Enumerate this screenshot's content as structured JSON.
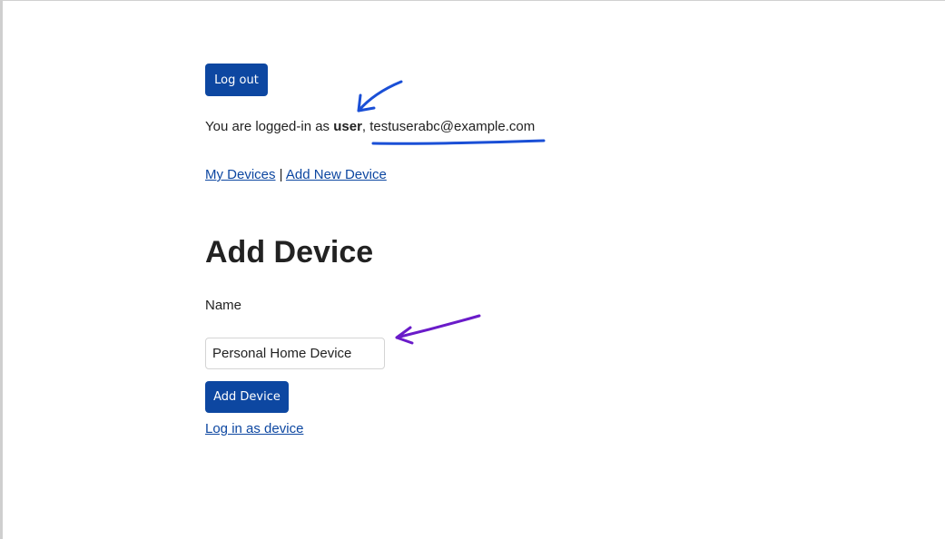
{
  "header": {
    "logout_label": "Log out"
  },
  "status": {
    "prefix": "You are logged-in as ",
    "role": "user",
    "separator": ", ",
    "email": "testuserabc@example.com"
  },
  "nav": {
    "items": [
      {
        "label": "My Devices"
      },
      {
        "label": "Add New Device"
      }
    ],
    "separator": " | "
  },
  "form": {
    "title": "Add Device",
    "name_label": "Name",
    "name_value": "Personal Home Device",
    "submit_label": "Add Device",
    "device_login_label": "Log in as device"
  },
  "annotations": {
    "arrow1_color": "#1a4fd6",
    "underline_color": "#1a4fd6",
    "arrow2_color": "#6a1bc9"
  }
}
